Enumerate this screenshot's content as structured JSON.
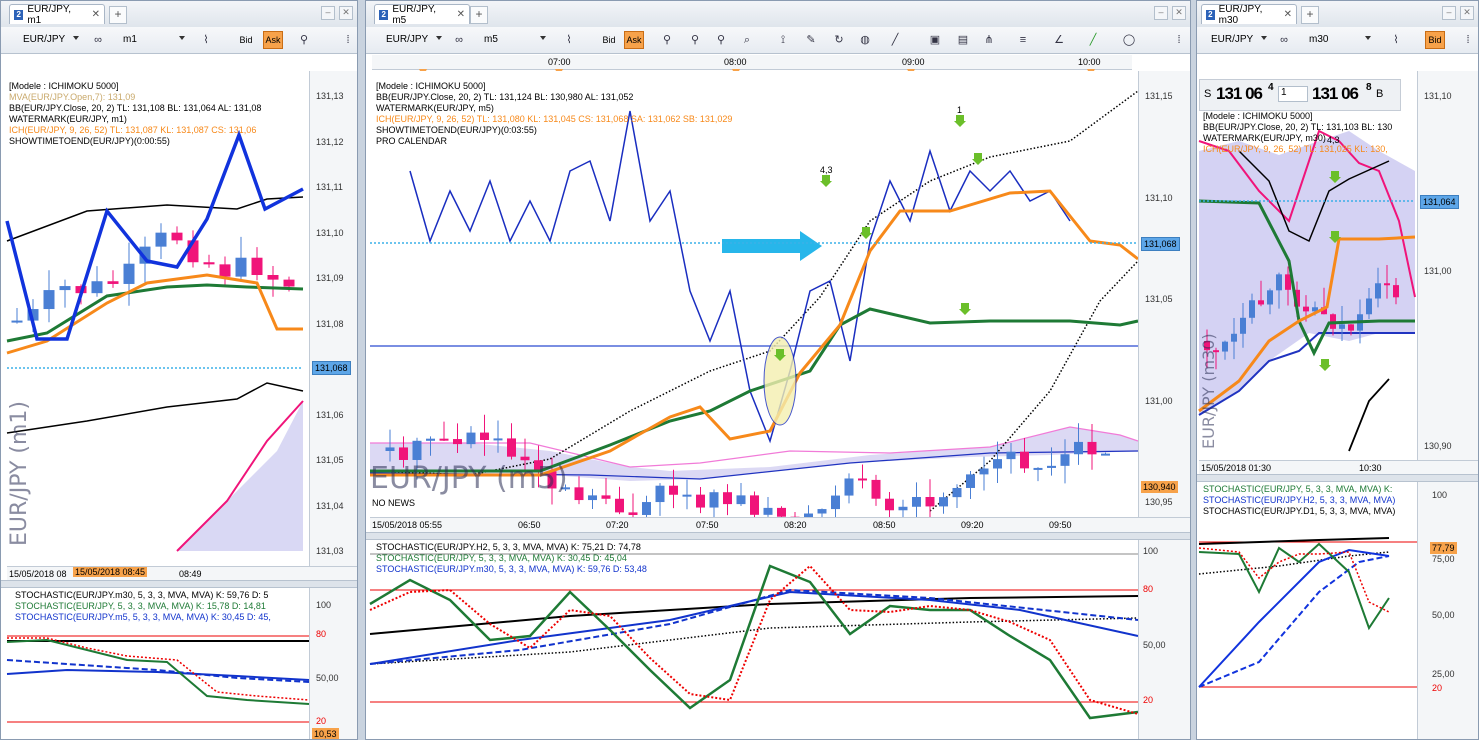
{
  "windows": {
    "left": {
      "tab": "EUR/JPY, m1",
      "symbol": "EUR/JPY",
      "timeframe": "m1",
      "bid": "Bid",
      "ask": "Ask",
      "legend": [
        "[Modele : ICHIMOKU 5000]",
        "MVA(EUR/JPY.Open,7): 131,09",
        "BB(EUR/JPY.Close, 20, 2)  TL: 131,108  BL: 131,064  AL: 131,08",
        "WATERMARK(EUR/JPY, m1)",
        "ICH(EUR/JPY, 9, 26, 52)  TL: 131,087  KL: 131,087  CS: 131,06",
        "SHOWTIMETOEND(EUR/JPY)(0:00:55)"
      ],
      "yticks": [
        "131,13",
        "131,12",
        "131,11",
        "131,10",
        "131,09",
        "131,08",
        "131,07",
        "131,06",
        "131,05",
        "131,04",
        "131,03"
      ],
      "price_tag": "131,068",
      "watermark": "EUR/JPY (m1)",
      "time_start": "15/05/2018 08",
      "time_cursor": "15/05/2018 08:45",
      "time_label": "08:49",
      "stoch_legend": [
        "STOCHASTIC(EUR/JPY.m30, 5, 3, 3, MVA, MVA)  K: 59,76  D: 5",
        "STOCHASTIC(EUR/JPY, 5, 3, 3, MVA, MVA)  K: 15,78  D: 14,81",
        "STOCHASTIC(EUR/JPY.m5, 5, 3, 3, MVA, MVA)  K: 30,45  D: 45,"
      ],
      "stoch_ticks": [
        "100",
        "80",
        "50,00",
        "20"
      ],
      "stoch_tag": "10,53"
    },
    "middle": {
      "tab": "EUR/JPY, m5",
      "symbol": "EUR/JPY",
      "timeframe": "m5",
      "bid": "Bid",
      "ask": "Ask",
      "top_times": [
        "07:00",
        "08:00",
        "09:00",
        "10:00"
      ],
      "legend": [
        "[Modele : ICHIMOKU 5000]",
        "BB(EUR/JPY.Close, 20, 2)  TL: 131,124  BL: 130,980  AL: 131,052",
        "WATERMARK(EUR/JPY, m5)",
        "ICH(EUR/JPY, 9, 26, 52)  TL: 131,080  KL: 131,045  CS: 131,068  SA: 131,062  SB: 131,029",
        "SHOWTIMETOEND(EUR/JPY)(0:03:55)",
        "PRO CALENDAR"
      ],
      "yticks": [
        "131,15",
        "131,10",
        "131,05",
        "131,00",
        "130,95"
      ],
      "price_tag": "131,068",
      "low_tag": "130,940",
      "watermark": "EUR/JPY (m5)",
      "no_news": "NO NEWS",
      "annot_1": "1",
      "annot_43": "4,3",
      "time_labels": [
        "15/05/2018 05:55",
        "06:50",
        "07:20",
        "07:50",
        "08:20",
        "08:50",
        "09:20",
        "09:50"
      ],
      "stoch_legend": [
        "STOCHASTIC(EUR/JPY.H2, 5, 3, 3, MVA, MVA)  K: 75,21  D: 74,78",
        "STOCHASTIC(EUR/JPY, 5, 3, 3, MVA, MVA)  K: 30,45  D: 45,04",
        "STOCHASTIC(EUR/JPY.m30, 5, 3, 3, MVA, MVA)  K: 59,76  D: 53,48"
      ],
      "stoch_ticks": [
        "100",
        "80",
        "50,00",
        "20"
      ]
    },
    "right": {
      "tab": "EUR/JPY, m30",
      "symbol": "EUR/JPY",
      "timeframe": "m30",
      "bid": "Bid",
      "quote_s": "S",
      "quote_sell_big": "131 06",
      "quote_sell_sup": "4",
      "quote_qty": "1",
      "quote_buy_big": "131 06",
      "quote_buy_sup": "8",
      "quote_b": "B",
      "legend": [
        "[Modele : ICHIMOKU 5000]",
        "BB(EUR/JPY.Close, 20, 2)  TL: 131,103  BL: 130",
        "WATERMARK(EUR/JPY, m30)",
        "ICH(EUR/JPY, 9, 26, 52)  TL: 131,025  KL: 130,"
      ],
      "yticks": [
        "131,10",
        "131,00",
        "130,90"
      ],
      "price_tag": "131,064",
      "watermark": "EUR/JPY (m30)",
      "annot_43": "4,3",
      "time_labels": [
        "15/05/2018 01:30",
        "10:30"
      ],
      "stoch_legend": [
        "STOCHASTIC(EUR/JPY, 5, 3, 3, MVA, MVA)  K:",
        "STOCHASTIC(EUR/JPY.H2, 5, 3, 3, MVA, MVA)",
        "STOCHASTIC(EUR/JPY.D1, 5, 3, 3, MVA, MVA)"
      ],
      "stoch_ticks": [
        "100",
        "75,00",
        "50,00",
        "25,00"
      ],
      "stoch_tag": "77,79",
      "stoch_20": "20"
    }
  },
  "colors": {
    "up": "#4a7fd4",
    "down": "#f0147a",
    "tenkan": "#f7891a",
    "kijun": "#1e7a35",
    "bb": "#000000",
    "chikou": "#1133cc",
    "tag_blue": "#5da6e8",
    "tag_orange": "#f7a24a"
  }
}
